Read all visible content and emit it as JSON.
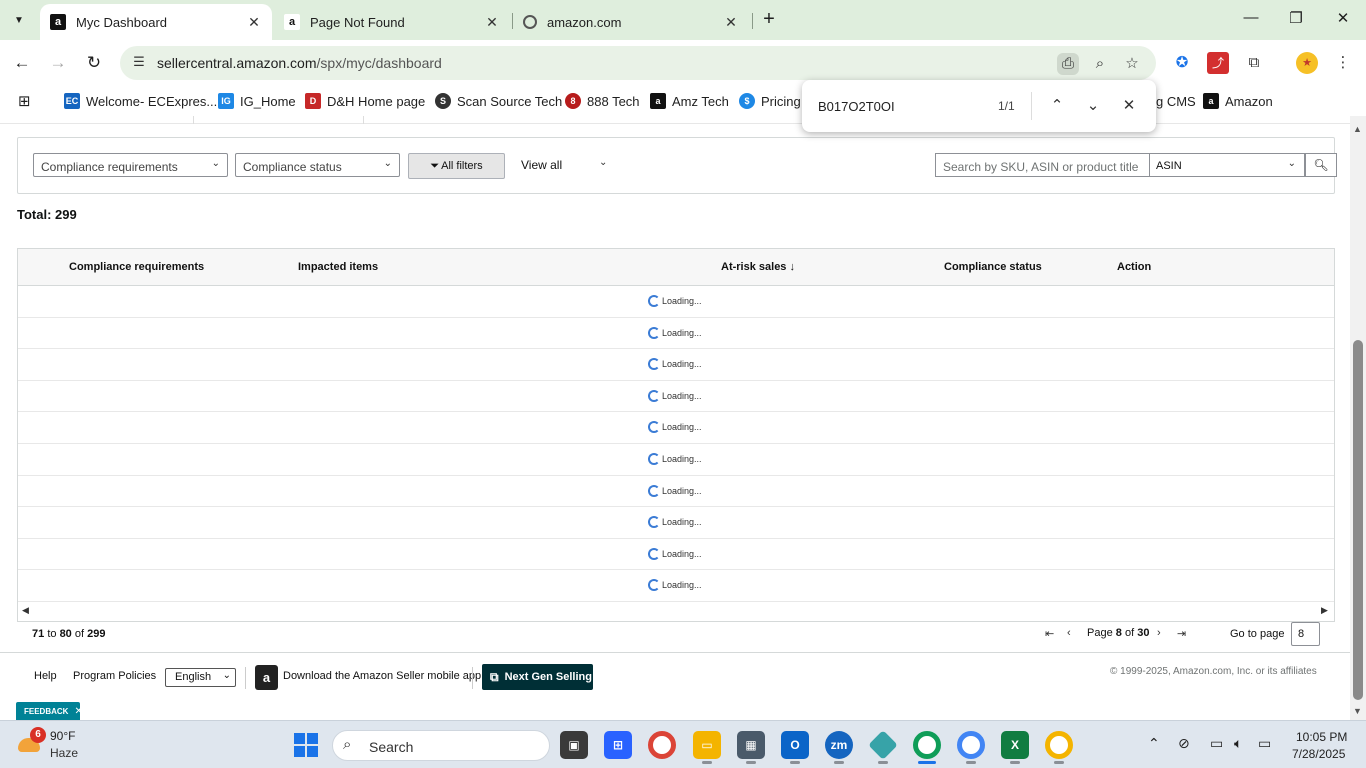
{
  "browser": {
    "tabs": [
      {
        "title": "Myc Dashboard",
        "favicon": "amazon-icon",
        "active": true
      },
      {
        "title": "Page Not Found",
        "favicon": "amazon-icon",
        "active": false
      },
      {
        "title": "amazon.com",
        "favicon": "globe-icon",
        "active": false
      }
    ],
    "url_host": "sellercentral.amazon.com",
    "url_path": "/spx/myc/dashboard",
    "bookmarks": [
      {
        "label": "Welcome- ECExpres...",
        "icon": "ec-icon"
      },
      {
        "label": "IG_Home",
        "icon": "ig-icon"
      },
      {
        "label": "D&H Home page",
        "icon": "dh-icon"
      },
      {
        "label": "Scan Source Tech",
        "icon": "scansource-icon"
      },
      {
        "label": "888 Tech",
        "icon": "888-icon"
      },
      {
        "label": "Amz Tech",
        "icon": "amazon-icon"
      },
      {
        "label": "Pricing",
        "icon": "pricing-icon"
      },
      {
        "label": "g CMS",
        "icon": "cms-icon"
      },
      {
        "label": "Amazon",
        "icon": "amazon-icon"
      }
    ],
    "find": {
      "query": "B017O2T0OI",
      "count": "1/1"
    }
  },
  "filters": {
    "compliance_requirements": "Compliance requirements",
    "compliance_status": "Compliance status",
    "all_filters": "All filters",
    "view_all": "View all",
    "search_placeholder": "Search by SKU, ASIN or product title",
    "search_type": "ASIN"
  },
  "summary": {
    "total": "Total: 299"
  },
  "table": {
    "columns": [
      "Compliance requirements",
      "Impacted items",
      "At-risk sales",
      "Compliance status",
      "Action"
    ],
    "rows": [
      "Loading...",
      "Loading...",
      "Loading...",
      "Loading...",
      "Loading...",
      "Loading...",
      "Loading...",
      "Loading...",
      "Loading...",
      "Loading..."
    ]
  },
  "pagination": {
    "range_start": "71",
    "range_to": "to",
    "range_end": "80",
    "range_of": "of",
    "range_total": "299",
    "page_label": "Page",
    "current_page": "8",
    "of_label": "of",
    "total_pages": "30",
    "goto_label": "Go to page",
    "goto_value": "8"
  },
  "footer": {
    "help": "Help",
    "program_policies": "Program Policies",
    "language": "English",
    "download_app": "Download the Amazon Seller mobile app",
    "next_gen": "Next Gen Selling",
    "copyright": "© 1999-2025, Amazon.com, Inc. or its affiliates",
    "feedback": "FEEDBACK"
  },
  "taskbar": {
    "weather_badge": "6",
    "temperature": "90°F",
    "condition": "Haze",
    "search_label": "Search",
    "time": "10:05 PM",
    "date": "7/28/2025"
  },
  "colors": {
    "tabbar_bg": "#dfeedd",
    "next_gen_button": "#002f36",
    "feedback_tab": "#008296",
    "spinner": "#3a7bd5"
  }
}
